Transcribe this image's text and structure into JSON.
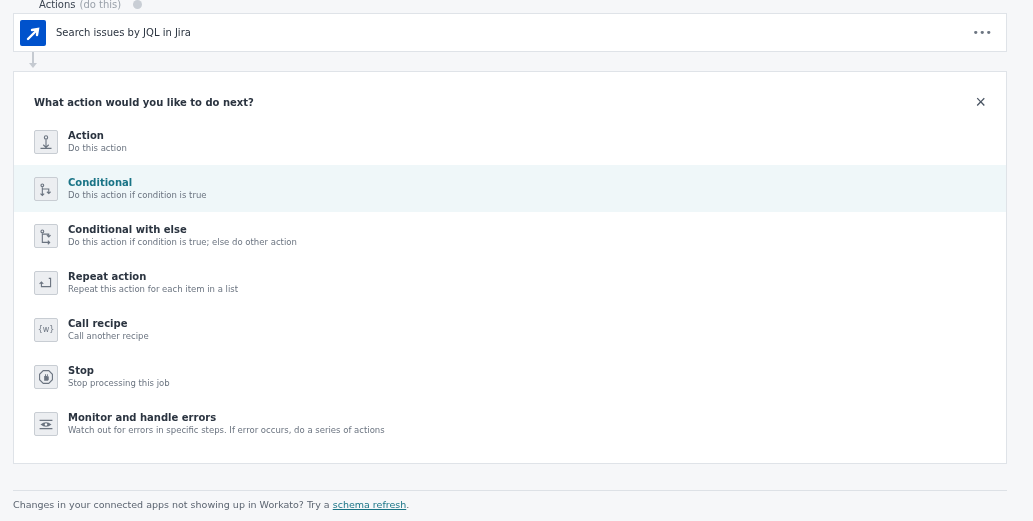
{
  "section": {
    "title": "Actions",
    "hint": "(do this)"
  },
  "step": {
    "label": "Search issues by JQL in Jira",
    "menu": "•••"
  },
  "panel": {
    "title": "What action would you like to do next?",
    "close": "×",
    "options": [
      {
        "kind": "action",
        "title": "Action",
        "description": "Do this action",
        "selected": false
      },
      {
        "kind": "conditional",
        "title": "Conditional",
        "description": "Do this action if condition is true",
        "selected": true
      },
      {
        "kind": "conditional_else",
        "title": "Conditional with else",
        "description": "Do this action if condition is true; else do other action",
        "selected": false
      },
      {
        "kind": "repeat",
        "title": "Repeat action",
        "description": "Repeat this action for each item in a list",
        "selected": false
      },
      {
        "kind": "call",
        "title": "Call recipe",
        "description": "Call another recipe",
        "selected": false,
        "icon_text": "{w}"
      },
      {
        "kind": "stop",
        "title": "Stop",
        "description": "Stop processing this job",
        "selected": false
      },
      {
        "kind": "monitor",
        "title": "Monitor and handle errors",
        "description": "Watch out for errors in specific steps. If error occurs, do a series of actions",
        "selected": false
      }
    ]
  },
  "footer": {
    "text": "Changes in your connected apps not showing up in Workato? Try a ",
    "link": "schema refresh",
    "end": "."
  }
}
